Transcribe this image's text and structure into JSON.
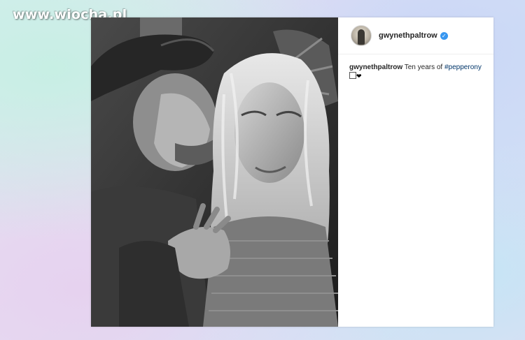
{
  "watermark": "www.wiocha.pl",
  "post": {
    "username": "gwynethpaltrow",
    "caption": {
      "user": "gwynethpaltrow",
      "text": "Ten years of ",
      "hashtag": "#pepperony",
      "emoji": "❤"
    }
  },
  "colors": {
    "verified_badge": "#3897f0",
    "hashtag": "#003569",
    "card_background": "#ffffff"
  },
  "icons": {
    "verified": "verified-check-icon",
    "heart": "heart-icon"
  }
}
